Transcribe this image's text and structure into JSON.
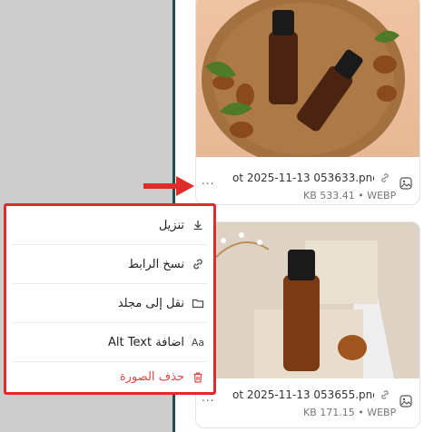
{
  "files": [
    {
      "name": "ot 2025-11-13 053633.png",
      "meta": "KB 533.41 • WEBP"
    },
    {
      "name": "ot 2025-11-13 053655.png",
      "meta": "KB 171.15 • WEBP"
    }
  ],
  "menu_dots": "...",
  "context_menu": {
    "items": [
      {
        "label": "تنزيل",
        "icon": "download-icon"
      },
      {
        "label": "نسخ الرابط",
        "icon": "link-icon"
      },
      {
        "label": "نقل إلى مجلد",
        "icon": "folder-icon"
      },
      {
        "label": "اضافة Alt Text",
        "icon": "alt-text-icon"
      },
      {
        "label": "حذف الصورة",
        "icon": "trash-icon"
      }
    ],
    "alt_icon_text": "Aa"
  },
  "colors": {
    "accent_red": "#e02b2b",
    "danger_text": "#e24747",
    "divider": "#1f4f4a"
  }
}
